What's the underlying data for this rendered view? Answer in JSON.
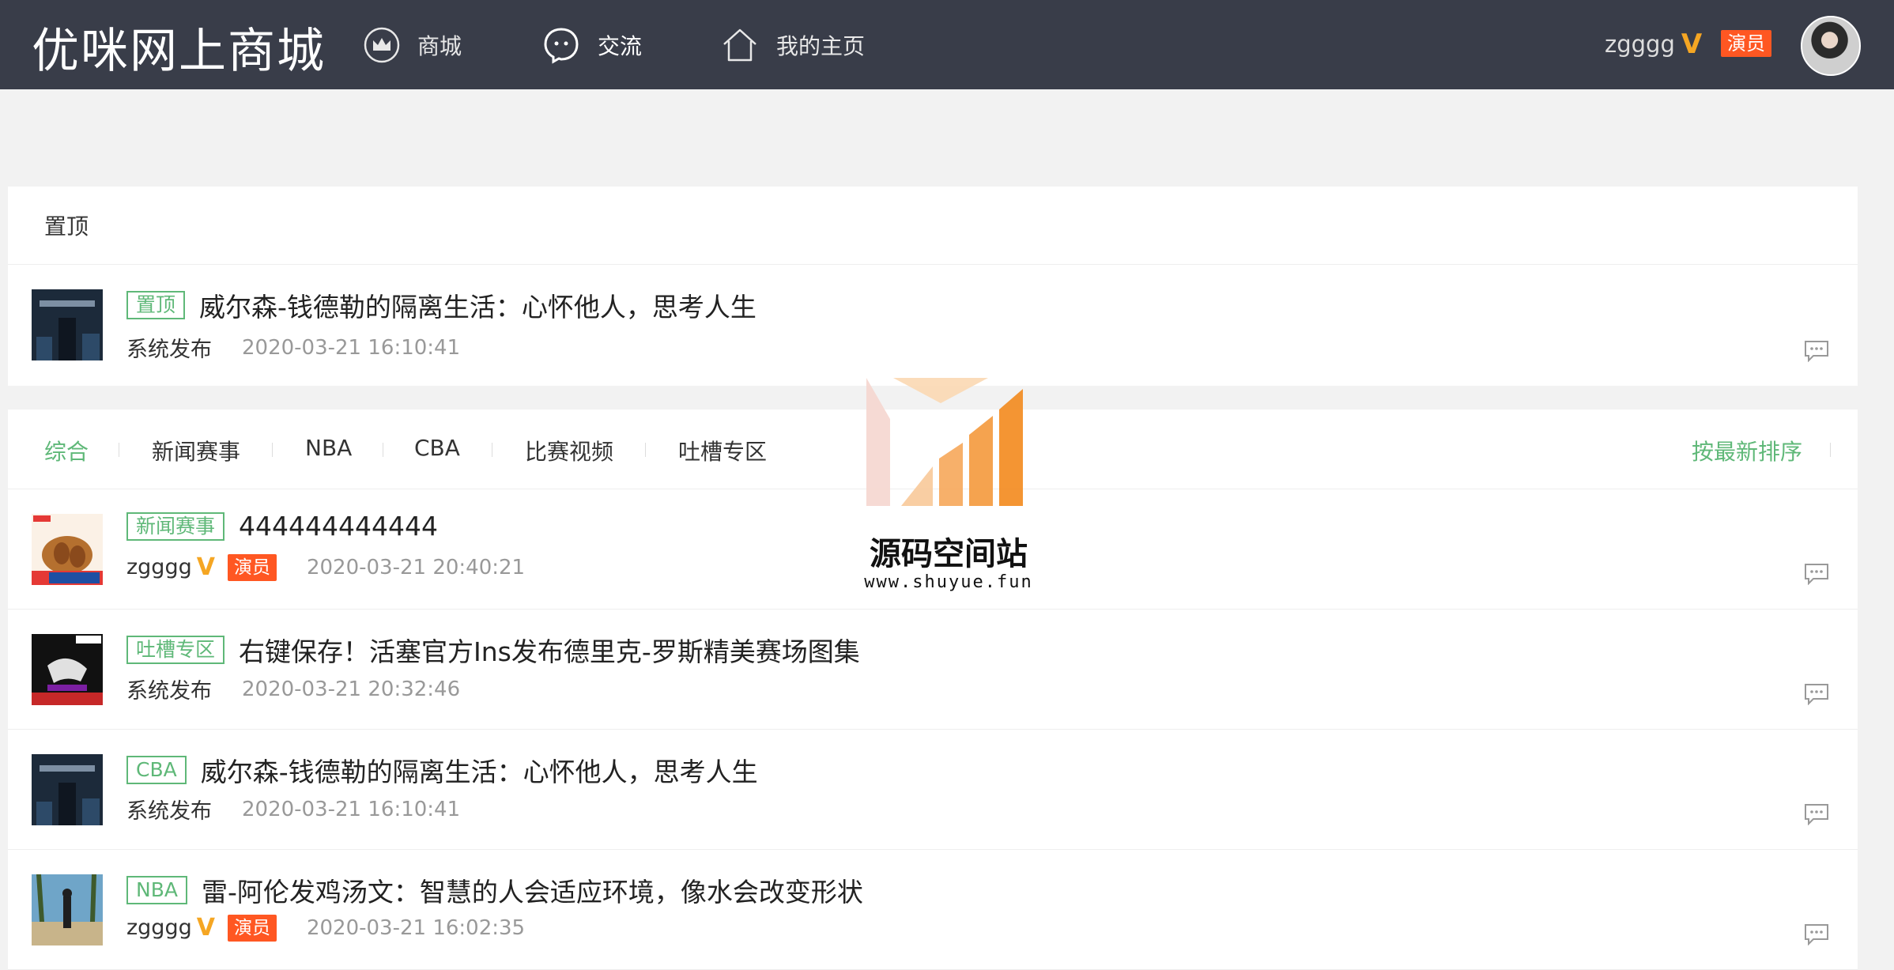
{
  "header": {
    "logo": "优咪网上商城",
    "nav": [
      {
        "label": "商城",
        "icon": "crown-icon"
      },
      {
        "label": "交流",
        "icon": "chat-bubble-icon"
      },
      {
        "label": "我的主页",
        "icon": "home-icon"
      }
    ],
    "user": {
      "name": "zgggg",
      "vip": "V",
      "role": "演员"
    }
  },
  "pinned": {
    "header": "置顶",
    "post": {
      "tag": "置顶",
      "title": "威尔森-钱德勒的隔离生活：心怀他人，思考人生",
      "author": "系统发布",
      "time": "2020-03-21 16:10:41"
    }
  },
  "tabs": [
    "综合",
    "新闻赛事",
    "NBA",
    "CBA",
    "比赛视频",
    "吐槽专区"
  ],
  "sort_label": "按最新排序",
  "posts": [
    {
      "tag": "新闻赛事",
      "title": "444444444444",
      "author": "zgggg",
      "vip": "V",
      "role": "演员",
      "time": "2020-03-21 20:40:21"
    },
    {
      "tag": "吐槽专区",
      "title": "右键保存！活塞官方Ins发布德里克-罗斯精美赛场图集",
      "author": "系统发布",
      "time": "2020-03-21 20:32:46"
    },
    {
      "tag": "CBA",
      "title": "威尔森-钱德勒的隔离生活：心怀他人，思考人生",
      "author": "系统发布",
      "time": "2020-03-21 16:10:41"
    },
    {
      "tag": "NBA",
      "title": "雷-阿伦发鸡汤文：智慧的人会适应环境，像水会改变形状",
      "author": "zgggg",
      "vip": "V",
      "role": "演员",
      "time": "2020-03-21 16:02:35"
    }
  ],
  "watermark": {
    "text": "源码空间站",
    "url": "www.shuyue.fun"
  },
  "colors": {
    "topbar": "#393d49",
    "accent": "#5fb878",
    "badge": "#ff5722",
    "vip": "#f5a623"
  }
}
